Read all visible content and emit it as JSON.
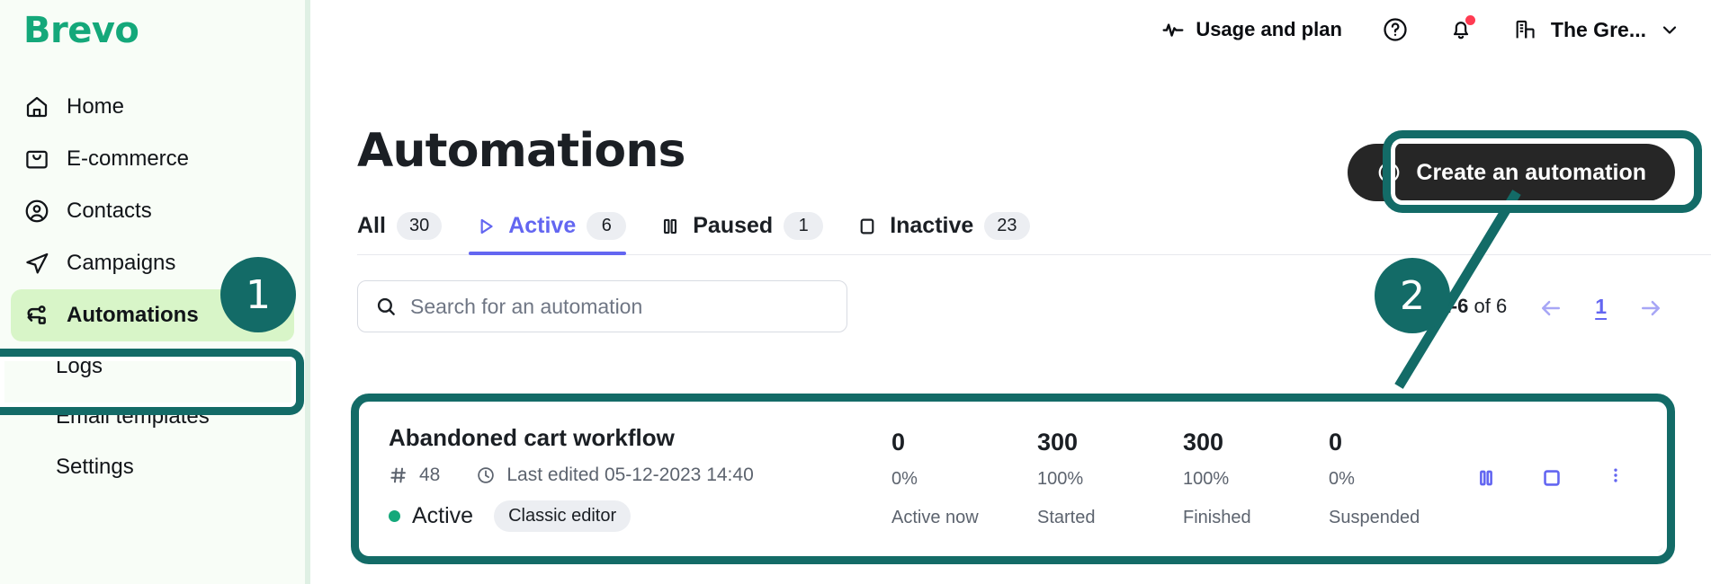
{
  "brand": {
    "name": "Brevo",
    "color": "#14a87a"
  },
  "sidebar": {
    "items": [
      {
        "label": "Home",
        "icon": "home-icon",
        "active": false
      },
      {
        "label": "E-commerce",
        "icon": "shopping-bag-icon",
        "active": false
      },
      {
        "label": "Contacts",
        "icon": "user-circle-icon",
        "active": false
      },
      {
        "label": "Campaigns",
        "icon": "paper-plane-icon",
        "active": false
      },
      {
        "label": "Automations",
        "icon": "automation-nodes-icon",
        "active": true
      }
    ],
    "sub_items": [
      {
        "label": "Logs"
      },
      {
        "label": "Email templates"
      },
      {
        "label": "Settings"
      }
    ]
  },
  "topbar": {
    "usage_label": "Usage and plan",
    "usage_icon": "pulse-activity-icon",
    "help_icon": "question-circle-icon",
    "notifications_icon": "bell-icon",
    "notifications_has_unread": true,
    "account_icon": "building-icon",
    "account_name": "The Gre...",
    "account_chevron_icon": "chevron-down-icon"
  },
  "page": {
    "title": "Automations",
    "create_button": {
      "label": "Create an automation",
      "icon": "plus-circle-icon"
    }
  },
  "tabs": [
    {
      "label": "All",
      "count": "30",
      "icon": null,
      "selected": false
    },
    {
      "label": "Active",
      "count": "6",
      "icon": "play-triangle-icon",
      "selected": true
    },
    {
      "label": "Paused",
      "count": "1",
      "icon": "pause-icon",
      "selected": false
    },
    {
      "label": "Inactive",
      "count": "23",
      "icon": "stop-square-icon",
      "selected": false
    }
  ],
  "search": {
    "placeholder": "Search for an automation",
    "value": "",
    "icon": "search-icon"
  },
  "pagination": {
    "range_bold": "1-6",
    "range_rest": " of 6",
    "prev_icon": "arrow-left-icon",
    "next_icon": "arrow-right-icon",
    "current_page": "1"
  },
  "automations": [
    {
      "name": "Abandoned cart workflow",
      "id_icon": "hash-icon",
      "id": "48",
      "clock_icon": "clock-icon",
      "last_edited": "Last edited 05-12-2023 14:40",
      "status": "Active",
      "status_color": "#14a87a",
      "editor_chip": "Classic editor",
      "stats": [
        {
          "value": "0",
          "percent": "0%",
          "label": "Active now"
        },
        {
          "value": "300",
          "percent": "100%",
          "label": "Started"
        },
        {
          "value": "300",
          "percent": "100%",
          "label": "Finished"
        },
        {
          "value": "0",
          "percent": "0%",
          "label": "Suspended"
        }
      ],
      "actions": [
        {
          "icon": "pause-icon"
        },
        {
          "icon": "stop-square-icon"
        },
        {
          "icon": "more-vertical-icon"
        }
      ]
    }
  ],
  "annotations": {
    "color": "#136b67",
    "markers": [
      {
        "number": "1",
        "target": "sidebar-item-automations"
      },
      {
        "number": "2",
        "target": "create-automation-button"
      }
    ]
  }
}
